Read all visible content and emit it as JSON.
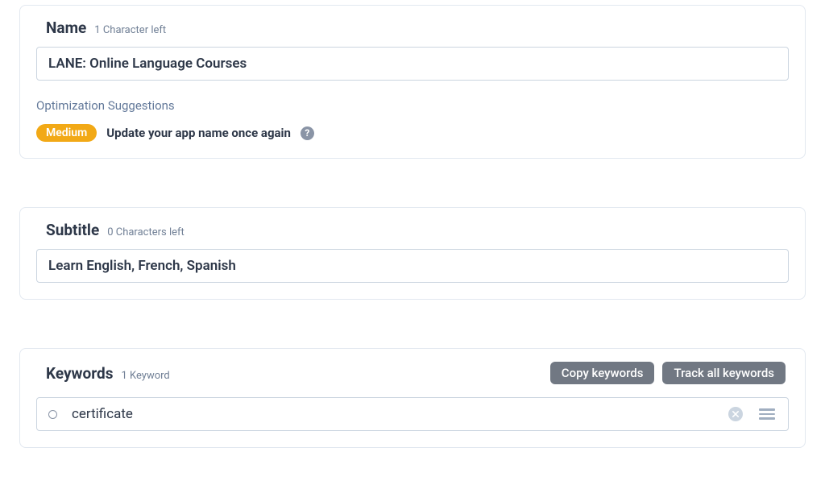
{
  "name_section": {
    "title": "Name",
    "char_left": "1 Character left",
    "value": "LANE: Online Language Courses",
    "optimization_label": "Optimization Suggestions",
    "suggestion": {
      "badge": "Medium",
      "text": "Update your app name once again"
    }
  },
  "subtitle_section": {
    "title": "Subtitle",
    "char_left": "0 Characters left",
    "value": "Learn English, French, Spanish"
  },
  "keywords_section": {
    "title": "Keywords",
    "count_label": "1 Keyword",
    "copy_button": "Copy keywords",
    "track_button": "Track all keywords",
    "keyword": "certificate"
  }
}
